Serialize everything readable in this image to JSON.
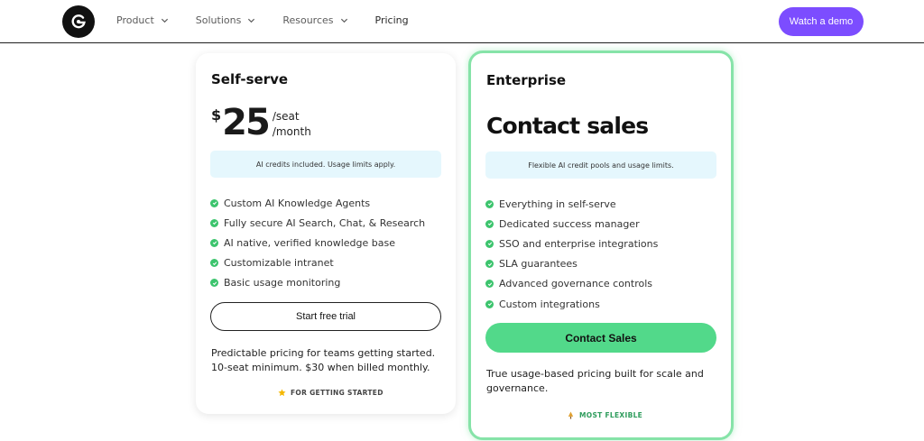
{
  "header": {
    "logo_icon": "g-logo-icon",
    "nav": [
      {
        "label": "Product",
        "has_dropdown": true
      },
      {
        "label": "Solutions",
        "has_dropdown": true
      },
      {
        "label": "Resources",
        "has_dropdown": true
      },
      {
        "label": "Pricing",
        "has_dropdown": false
      }
    ],
    "demo_label": "Watch a demo",
    "accent": "#7c4dff"
  },
  "self_serve": {
    "title": "Self-serve",
    "currency": "$",
    "amount": "25",
    "per_seat": "/seat",
    "per_month": "/month",
    "note": "AI credits included. Usage limits apply.",
    "features": [
      "Custom AI Knowledge Agents",
      "Fully secure AI Search, Chat, & Research",
      "AI native, verified knowledge base",
      "Customizable intranet",
      "Basic usage monitoring"
    ],
    "cta": "Start free trial",
    "description": "Predictable pricing for teams getting started. 10-seat minimum. $30 when billed monthly.",
    "tag": "FOR GETTING STARTED",
    "tag_icon": "star-icon"
  },
  "enterprise": {
    "title": "Enterprise",
    "headline": "Contact sales",
    "note": "Flexible AI credit pools and usage limits.",
    "features": [
      "Everything in self-serve",
      "Dedicated success manager",
      "SSO and enterprise integrations",
      "SLA guarantees",
      "Advanced governance controls",
      "Custom integrations"
    ],
    "cta": "Contact Sales",
    "description": "True usage-based pricing built for scale and governance.",
    "tag": "MOST FLEXIBLE",
    "tag_icon": "tree-icon",
    "border_color": "#86e3a8",
    "button_color": "#52d98a"
  },
  "check_icon": "check-circle-icon",
  "check_color": "#3cc46d"
}
